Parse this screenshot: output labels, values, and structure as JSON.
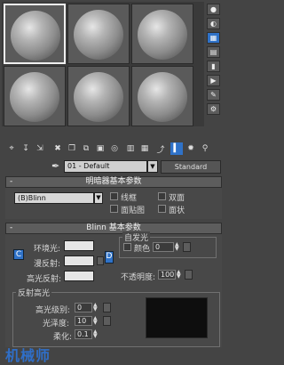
{
  "toolbar": {
    "material_name": "01 - Default",
    "material_type": "Standard"
  },
  "shader_rollout": {
    "title": "明暗器基本参数",
    "toggle": "-",
    "shader_type": "(B)Blinn",
    "options": {
      "wire": "线框",
      "two_sided": "双面",
      "face_map": "面贴图",
      "faceted": "面状"
    }
  },
  "blinn_rollout": {
    "title": "Blinn 基本参数",
    "toggle": "-",
    "ambient_label": "环境光:",
    "diffuse_label": "漫反射:",
    "specular_label": "高光反射:",
    "lock_c": "C",
    "lock_d": "D",
    "self_illum": {
      "title": "自发光",
      "color_label": "颜色",
      "value": "0"
    },
    "opacity": {
      "label": "不透明度:",
      "value": "100"
    },
    "specular_highlights": {
      "title": "反射高光",
      "level_label": "高光级别:",
      "level_value": "0",
      "gloss_label": "光泽度:",
      "gloss_value": "10",
      "soften_label": "柔化:",
      "soften_value": "0.1"
    }
  },
  "overlay_text": "机械师",
  "colors": {
    "accent": "#2f72c8",
    "panel": "#484848",
    "background": "#444444"
  }
}
